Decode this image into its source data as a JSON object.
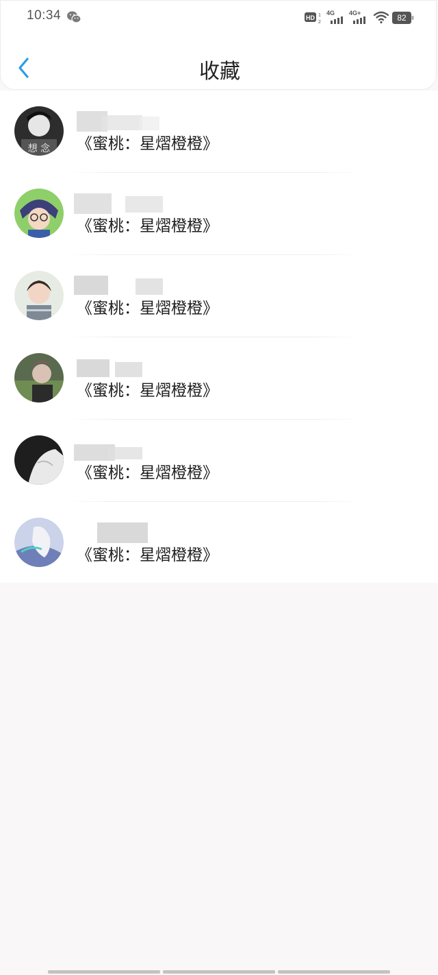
{
  "status_bar": {
    "time": "10:34",
    "battery": "82",
    "network_1": "4G",
    "network_2": "4G+",
    "icons": [
      "wechat-icon",
      "hd-icon",
      "signal-icon",
      "signal-icon",
      "wifi-icon",
      "battery-icon"
    ]
  },
  "header": {
    "title": "收藏",
    "back_icon": "chevron-left-icon"
  },
  "colors": {
    "accent": "#2a9de4",
    "background": "#f9f7f8",
    "card": "#ffffff",
    "text": "#1e1e1e"
  },
  "favorites": [
    {
      "avatar": "avatar-1",
      "title": "《蜜桃：星熠橙橙》"
    },
    {
      "avatar": "avatar-2",
      "title": "《蜜桃：星熠橙橙》"
    },
    {
      "avatar": "avatar-3",
      "title": "《蜜桃：星熠橙橙》"
    },
    {
      "avatar": "avatar-4",
      "title": "《蜜桃：星熠橙橙》"
    },
    {
      "avatar": "avatar-5",
      "title": "《蜜桃：星熠橙橙》"
    },
    {
      "avatar": "avatar-6",
      "title": "《蜜桃：星熠橙橙》"
    }
  ]
}
